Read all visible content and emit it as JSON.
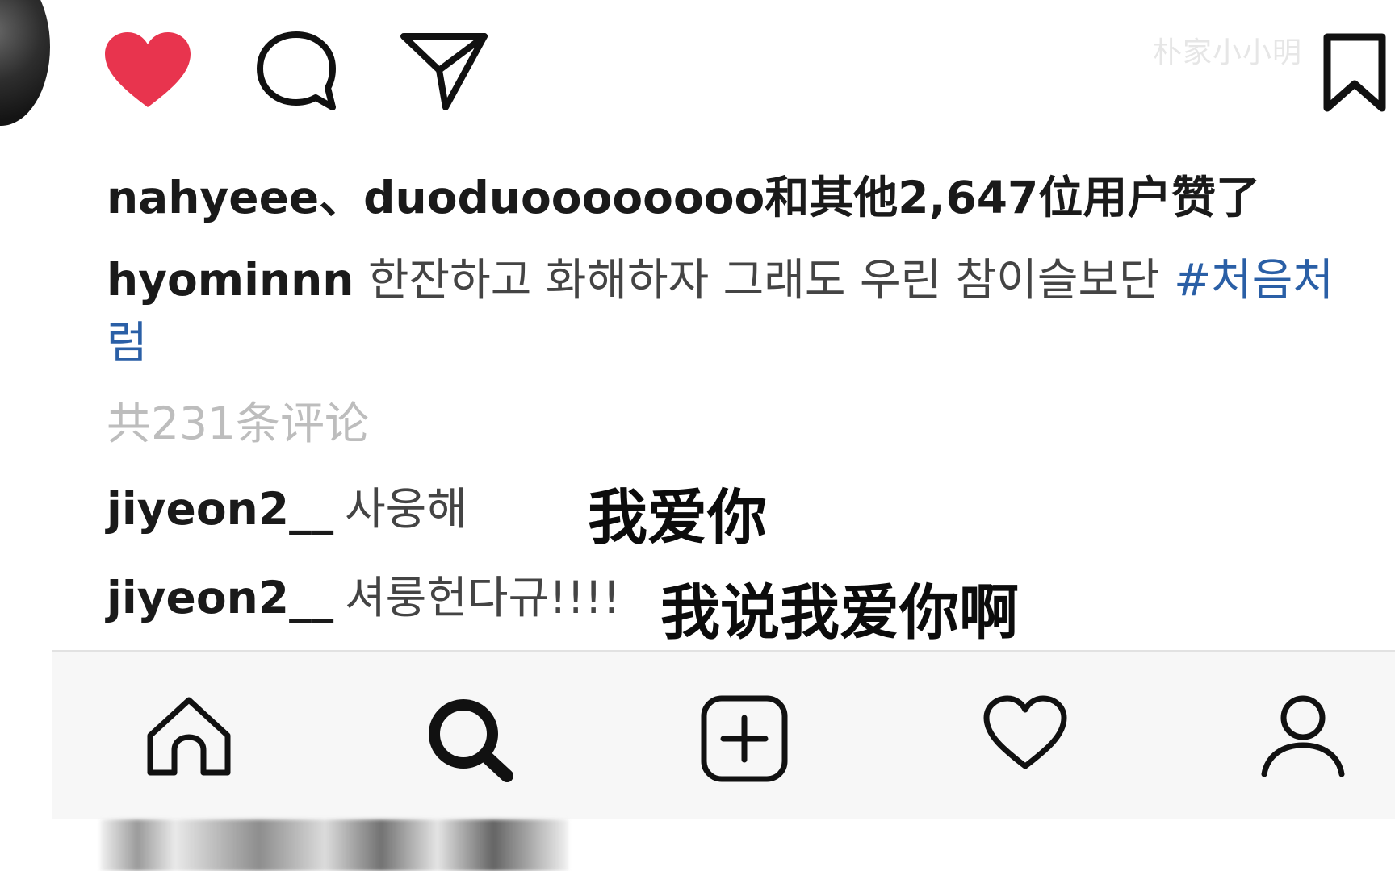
{
  "watermark": "朴家小小明",
  "post": {
    "likes_text": "nahyeee、duoduoooooooo和其他2,647位用户赞了",
    "caption": {
      "username": "hyominnn",
      "text": "한잔하고 화해하자 그래도 우린 참이슬보단",
      "hashtag": "#처음처럼"
    },
    "comments_count_text": "共231条评论",
    "comments": [
      {
        "username": "jiyeon2__",
        "text": "사웅해"
      },
      {
        "username": "jiyeon2__",
        "text": "셔룽헌다규!!!!"
      }
    ]
  },
  "overlays": {
    "subtitle_1": "我爱你",
    "subtitle_2": "我说我爱你啊"
  },
  "icons": {
    "like": "heart-filled-icon",
    "comment": "comment-bubble-icon",
    "share": "paper-plane-icon",
    "save": "bookmark-icon"
  },
  "nav": {
    "items": [
      "home-icon",
      "search-icon",
      "add-post-icon",
      "activity-heart-icon",
      "profile-icon"
    ]
  },
  "colors": {
    "like_red": "#e8344e",
    "hashtag_blue": "#2a5fa6",
    "muted_gray": "#bdbdbd"
  }
}
